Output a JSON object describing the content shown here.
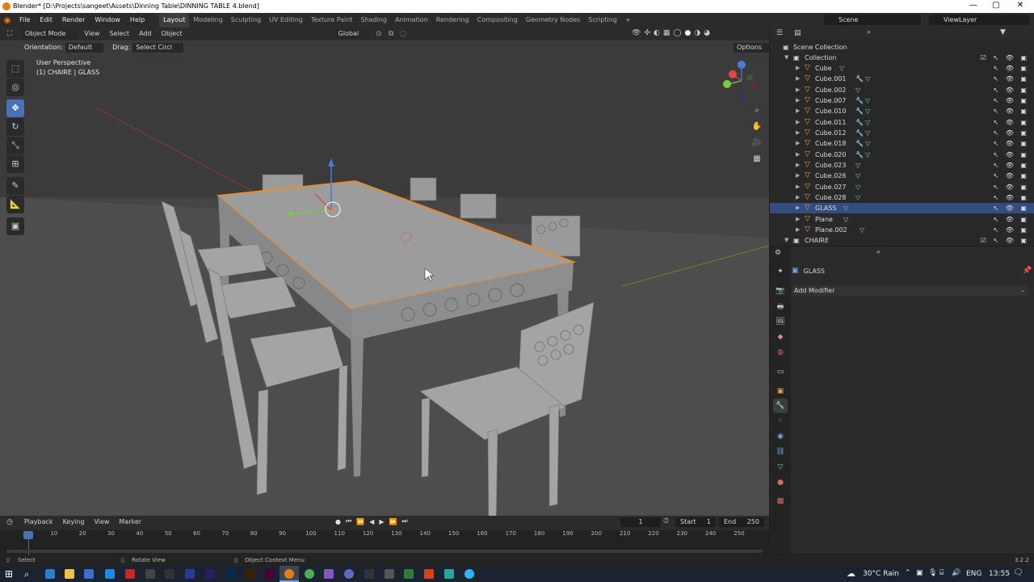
{
  "title_bar": {
    "title": "Blender* [D:\\Projects\\sangeet\\Assets\\Dinning Table\\DINNING TABLE 4.blend]",
    "minimize": "—",
    "maximize": "▢",
    "close": "✕"
  },
  "menu": {
    "items": [
      "File",
      "Edit",
      "Render",
      "Window",
      "Help"
    ],
    "workspaces": [
      "Layout",
      "Modeling",
      "Sculpting",
      "UV Editing",
      "Texture Paint",
      "Shading",
      "Animation",
      "Rendering",
      "Compositing",
      "Geometry Nodes",
      "Scripting"
    ],
    "active_workspace": "Layout",
    "add_tab": "+",
    "scene": "Scene",
    "view_layer": "ViewLayer"
  },
  "viewport_header": {
    "mode": "Object Mode",
    "menus": [
      "View",
      "Select",
      "Add",
      "Object"
    ],
    "transform_orientation": "Global",
    "orientation_label": "Orientation:",
    "orientation_value": "Default",
    "drag_label": "Drag:",
    "drag_value": "Select Circl",
    "options": "Options"
  },
  "viewport": {
    "perspective": "User Perspective",
    "selection": "(1) CHAIRE | GLASS",
    "gizmo_axes": [
      "X",
      "Y",
      "Z"
    ]
  },
  "tools": [
    {
      "name": "select-tool",
      "glyph": "⬚"
    },
    {
      "name": "cursor-tool",
      "glyph": "◎"
    },
    {
      "name": "move-tool",
      "glyph": "✥"
    },
    {
      "name": "rotate-tool",
      "glyph": "↻"
    },
    {
      "name": "scale-tool",
      "glyph": "⤡"
    },
    {
      "name": "transform-tool",
      "glyph": "⊞"
    },
    {
      "name": "annotate-tool",
      "glyph": "✎"
    },
    {
      "name": "measure-tool",
      "glyph": "📐"
    },
    {
      "name": "add-cube-tool",
      "glyph": "▣"
    }
  ],
  "outliner": {
    "root": "Scene Collection",
    "collection": "Collection",
    "objects": [
      {
        "name": "Cube",
        "mod": false
      },
      {
        "name": "Cube.001",
        "mod": true
      },
      {
        "name": "Cube.002",
        "mod": false
      },
      {
        "name": "Cube.007",
        "mod": true
      },
      {
        "name": "Cube.010",
        "mod": true
      },
      {
        "name": "Cube.011",
        "mod": true
      },
      {
        "name": "Cube.012",
        "mod": true
      },
      {
        "name": "Cube.018",
        "mod": true
      },
      {
        "name": "Cube.020",
        "mod": true
      },
      {
        "name": "Cube.023",
        "mod": false
      },
      {
        "name": "Cube.026",
        "mod": false
      },
      {
        "name": "Cube.027",
        "mod": false
      },
      {
        "name": "Cube.028",
        "mod": false
      },
      {
        "name": "GLASS",
        "mod": false,
        "selected": true
      },
      {
        "name": "Plane",
        "mod": false
      },
      {
        "name": "Plane.002",
        "mod": false
      }
    ],
    "collection2": "CHAIRE"
  },
  "properties": {
    "object_name": "GLASS",
    "add_modifier": "Add Modifier"
  },
  "timeline": {
    "menus": [
      "Playback",
      "Keying",
      "View",
      "Marker"
    ],
    "current_frame": "1",
    "start_label": "Start",
    "start": "1",
    "end_label": "End",
    "end": "250",
    "ticks": [
      "1",
      "10",
      "20",
      "30",
      "40",
      "50",
      "60",
      "70",
      "80",
      "90",
      "100",
      "110",
      "120",
      "130",
      "140",
      "150",
      "160",
      "170",
      "180",
      "190",
      "200",
      "210",
      "220",
      "230",
      "240",
      "250"
    ]
  },
  "status_bar": {
    "select": "Select",
    "rotate": "Rotate View",
    "context": "Object Context Menu",
    "version": "3.2.2"
  },
  "taskbar": {
    "weather": "30°C Rain",
    "language": "ENG",
    "time": "13:55"
  },
  "colors": {
    "accent": "#4772b3",
    "selection_outline": "#f08a24",
    "viewport_bg": "#3b3b3b"
  }
}
